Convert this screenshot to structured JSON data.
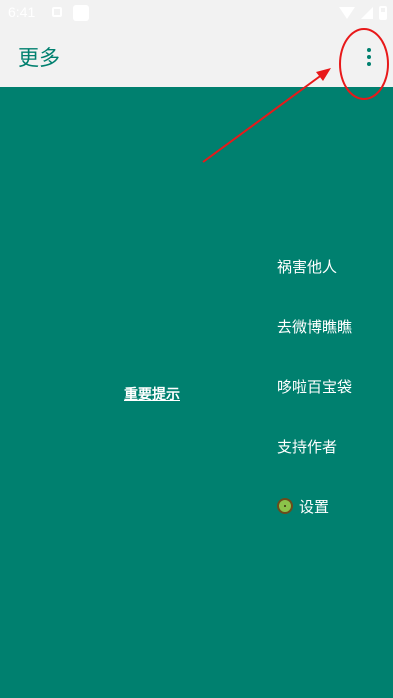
{
  "status_bar": {
    "time": "6:41",
    "icons": [
      "notification-icon",
      "app-icon",
      "wifi-icon",
      "signal-icon",
      "battery-icon"
    ]
  },
  "app_bar": {
    "title": "更多",
    "overflow_icon": "more-vert-icon",
    "accent_color": "#00806f",
    "background_color": "#f2f2f2"
  },
  "main": {
    "background_color": "#00806f",
    "notice_link": "重要提示",
    "menu_items": [
      {
        "label": "祸害他人"
      },
      {
        "label": "去微博瞧瞧"
      },
      {
        "label": "哆啦百宝袋"
      },
      {
        "label": "支持作者"
      },
      {
        "label": "设置",
        "icon": "kiwi-icon"
      }
    ]
  },
  "annotation": {
    "color": "#e8191a",
    "shapes": [
      "circle",
      "arrow"
    ]
  }
}
